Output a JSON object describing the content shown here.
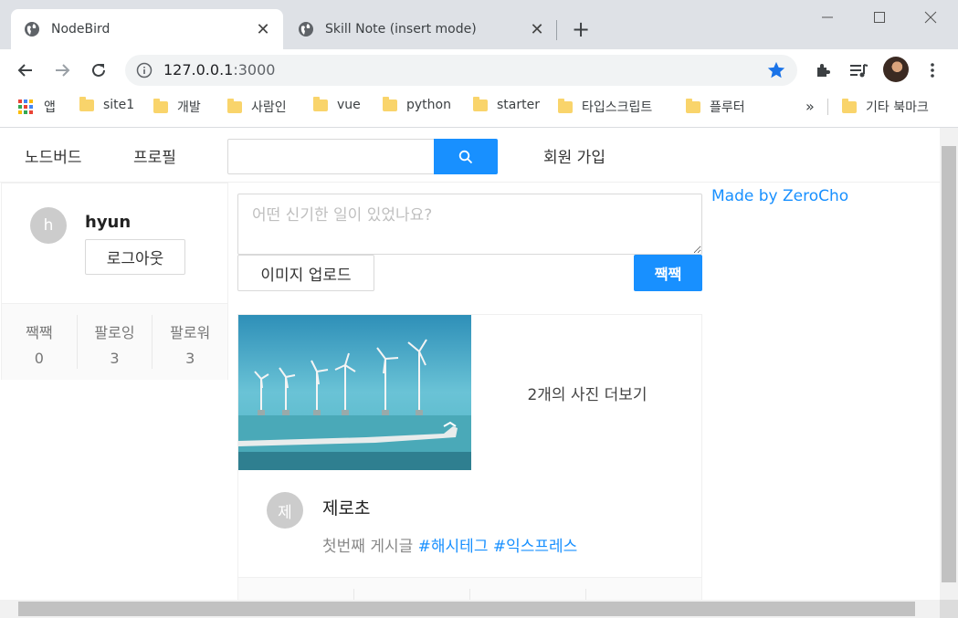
{
  "browser": {
    "tabs": [
      {
        "title": "NodeBird",
        "active": true
      },
      {
        "title": "Skill Note (insert mode)",
        "active": false
      }
    ],
    "url_host": "127.0.0.1",
    "url_port": ":3000",
    "bookmarks": [
      {
        "label": "앱",
        "icon": "apps-icon"
      },
      {
        "label": "site1"
      },
      {
        "label": "개발"
      },
      {
        "label": "사람인"
      },
      {
        "label": "vue"
      },
      {
        "label": "python"
      },
      {
        "label": "starter"
      },
      {
        "label": "타입스크립트"
      },
      {
        "label": "플루터"
      }
    ],
    "bookmarks_overflow": "»",
    "other_bookmarks": "기타 북마크"
  },
  "menu": {
    "home": "노드버드",
    "profile": "프로필",
    "signup": "회원 가입",
    "search_placeholder": ""
  },
  "user_profile": {
    "avatar_initial": "h",
    "nickname": "hyun",
    "logout_label": "로그아웃",
    "stats": [
      {
        "label": "짹짹",
        "value": "0"
      },
      {
        "label": "팔로잉",
        "value": "3"
      },
      {
        "label": "팔로워",
        "value": "3"
      }
    ]
  },
  "post_form": {
    "placeholder": "어떤 신기한 일이 있었나요?",
    "upload_label": "이미지 업로드",
    "submit_label": "짹짹"
  },
  "post": {
    "more_photos": "2개의 사진 더보기",
    "author_initial": "제",
    "author": "제로초",
    "text": "첫번째 게시글",
    "hashtags": [
      "#해시테그",
      "#익스프레스"
    ]
  },
  "footer_link": "Made by ZeroCho",
  "colors": {
    "primary": "#1890ff",
    "bookmark_folder": "#f9d46b",
    "bookmark_star": "#1a73e8"
  }
}
